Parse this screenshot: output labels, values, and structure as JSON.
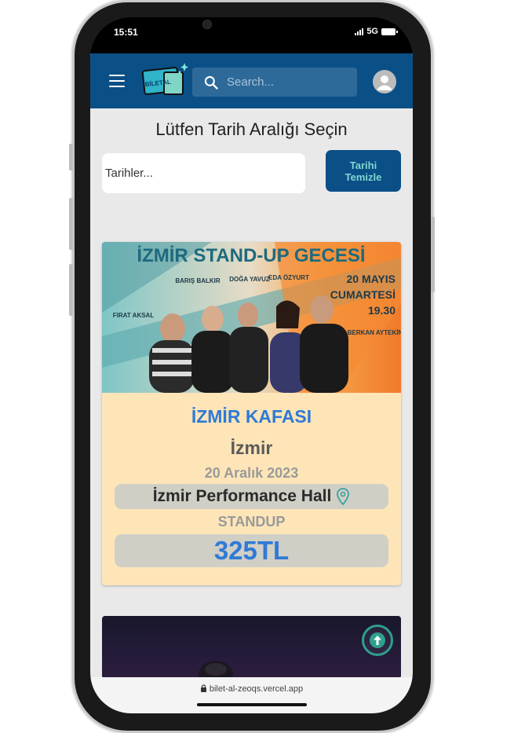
{
  "status": {
    "time": "15:51",
    "network": "5G"
  },
  "navbar": {
    "logo_text": "BİLETAL",
    "search_placeholder": "Search..."
  },
  "filter": {
    "heading": "Lütfen Tarih Aralığı Seçin",
    "dates_placeholder": "Tarihler...",
    "clear_label_line1": "Tarihi",
    "clear_label_line2": "Temizle"
  },
  "event": {
    "banner": {
      "title": "İZMİR STAND-UP GECESİ",
      "date_line1": "20 MAYIS",
      "date_line2": "CUMARTESİ",
      "time": "19.30",
      "performers": [
        "FIRAT AKSAL",
        "BARIŞ BALKIR",
        "DOĞA YAVUZ",
        "EDA ÖZYURT",
        "BERKAN AYTEKİN"
      ]
    },
    "title": "İZMİR KAFASI",
    "city": "İzmir",
    "date": "20 Aralık 2023",
    "venue": "İzmir Performance Hall",
    "category": "STANDUP",
    "price": "325TL"
  },
  "browser": {
    "url": "bilet-al-zeoqs.vercel.app"
  },
  "colors": {
    "navbar": "#0b4f87",
    "accent_blue": "#2f7ad6",
    "card_bg": "#fee5b8",
    "teal": "#2e9f8e"
  },
  "icons": [
    "menu-icon",
    "search-icon",
    "user-icon",
    "location-pin-icon",
    "arrow-up-icon",
    "lock-icon"
  ]
}
